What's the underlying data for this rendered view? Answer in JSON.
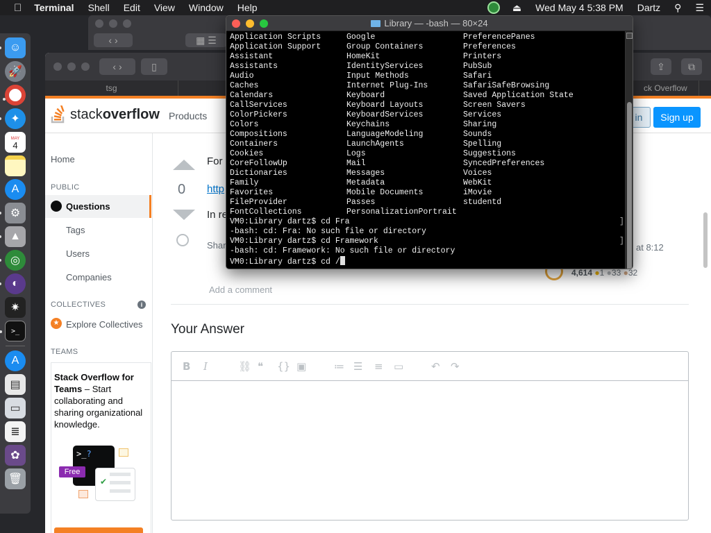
{
  "menubar": {
    "app_name": "Terminal",
    "menus": [
      "Shell",
      "Edit",
      "View",
      "Window",
      "Help"
    ],
    "datetime": "Wed May 4  5:38 PM",
    "user": "Dartz"
  },
  "dock": {
    "items": [
      "finder-icon",
      "launchpad-icon",
      "chrome-icon",
      "safari-icon",
      "calendar-icon",
      "notes-icon",
      "app-store-icon",
      "system-preferences-icon",
      "preview-icon",
      "globe-app-icon",
      "tor-browser-icon",
      "photo-booth-icon",
      "terminal-icon",
      "app-store-2-icon",
      "printer-icon",
      "screenshot-icon",
      "document-icon",
      "photos-icon",
      "trash-icon"
    ],
    "calendar_month": "MAY",
    "calendar_day": "4"
  },
  "safari": {
    "tabs": [
      "tsg",
      "ck Overflow"
    ]
  },
  "stackoverflow": {
    "logo_light": "stack",
    "logo_bold": "overflow",
    "products": "Products",
    "login_partial": "in",
    "signup": "Sign up",
    "nav": {
      "home": "Home",
      "public_heading": "PUBLIC",
      "questions": "Questions",
      "tags": "Tags",
      "users": "Users",
      "companies": "Companies",
      "collectives_heading": "COLLECTIVES",
      "explore_collectives": "Explore Collectives",
      "teams_heading": "TEAMS",
      "teams_title": "Stack Overflow for Teams",
      "teams_dash": " – ",
      "teams_text": "Start collaborating and sharing organizational knowledge.",
      "free_badge": "Free"
    },
    "post": {
      "vote_count": "0",
      "line1": "For",
      "link_partial": "http",
      "line3": "In re",
      "share_partial": "Shar",
      "time_partial": "at 8:12",
      "rep_score": "4,614",
      "rep_gold": "1",
      "rep_silver": "33",
      "rep_bronze": "32",
      "add_comment": "Add a comment"
    },
    "your_answer": "Your Answer",
    "editor_tools": [
      "B",
      "I",
      "⛓",
      "❝",
      "{}",
      "▣",
      "≔",
      "☰",
      "≡",
      "▭",
      "↶",
      "↷"
    ]
  },
  "terminal": {
    "title": "Library — -bash — 80×24",
    "columns": [
      [
        "Application Scripts",
        "Application Support",
        "Assistant",
        "Assistants",
        "Audio",
        "Caches",
        "Calendars",
        "CallServices",
        "ColorPickers",
        "Colors",
        "Compositions",
        "Containers",
        "Cookies",
        "CoreFollowUp",
        "Dictionaries",
        "Family",
        "Favorites",
        "FileProvider",
        "FontCollections"
      ],
      [
        "Google",
        "Group Containers",
        "HomeKit",
        "IdentityServices",
        "Input Methods",
        "Internet Plug-Ins",
        "Keyboard",
        "Keyboard Layouts",
        "KeyboardServices",
        "Keychains",
        "LanguageModeling",
        "LaunchAgents",
        "Logs",
        "Mail",
        "Messages",
        "Metadata",
        "Mobile Documents",
        "Passes",
        "PersonalizationPortrait"
      ],
      [
        "PreferencePanes",
        "Preferences",
        "Printers",
        "PubSub",
        "Safari",
        "SafariSafeBrowsing",
        "Saved Application State",
        "Screen Savers",
        "Services",
        "Sharing",
        "Sounds",
        "Spelling",
        "Suggestions",
        "SyncedPreferences",
        "Voices",
        "WebKit",
        "iMovie",
        "studentd",
        ""
      ]
    ],
    "history": [
      "VM0:Library dartz$ cd Fra",
      "-bash: cd: Fra: No such file or directory",
      "VM0:Library dartz$ cd Framework",
      "-bash: cd: Framework: No such file or directory"
    ],
    "prompt": "VM0:Library dartz$ cd /"
  }
}
